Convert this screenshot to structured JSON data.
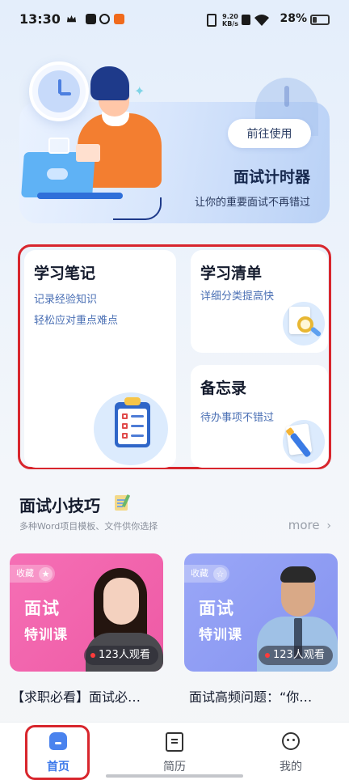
{
  "status_bar": {
    "time": "13:30",
    "net_speed_value": "9.20",
    "net_speed_unit": "KB/s",
    "battery": "28%",
    "icons": [
      "crown-icon",
      "play-icon",
      "logo-icon",
      "app-icon",
      "vibrate-icon",
      "x-icon",
      "wifi-icon",
      "battery-icon"
    ]
  },
  "hero": {
    "button_label": "前往使用",
    "title": "面试计时器",
    "subtitle": "让你的重要面试不再错过"
  },
  "features": {
    "notes": {
      "title": "学习笔记",
      "line1": "记录经验知识",
      "line2": "轻松应对重点难点"
    },
    "checklist": {
      "title": "学习清单",
      "desc": "详细分类提高快"
    },
    "memo": {
      "title": "备忘录",
      "desc": "待办事项不错过"
    }
  },
  "tips": {
    "title": "面试小技巧",
    "subtitle": "多种Word项目模板、文件供你选择",
    "more_label": "more",
    "courses": [
      {
        "fav_label": "收藏",
        "big": "面试",
        "small": "特训课",
        "views": "123人观看",
        "caption": "【求职必看】面试必…",
        "color": "#f06aae"
      },
      {
        "fav_label": "收藏",
        "big": "面试",
        "small": "特训课",
        "views": "123人观看",
        "caption": "面试高频问题：“你…",
        "color": "#8d9af2"
      }
    ]
  },
  "tab_bar": {
    "items": [
      {
        "label": "首页",
        "icon": "home-icon",
        "active": true
      },
      {
        "label": "简历",
        "icon": "resume-icon",
        "active": false
      },
      {
        "label": "我的",
        "icon": "profile-icon",
        "active": false
      }
    ],
    "active_color": "#3b78ea"
  }
}
